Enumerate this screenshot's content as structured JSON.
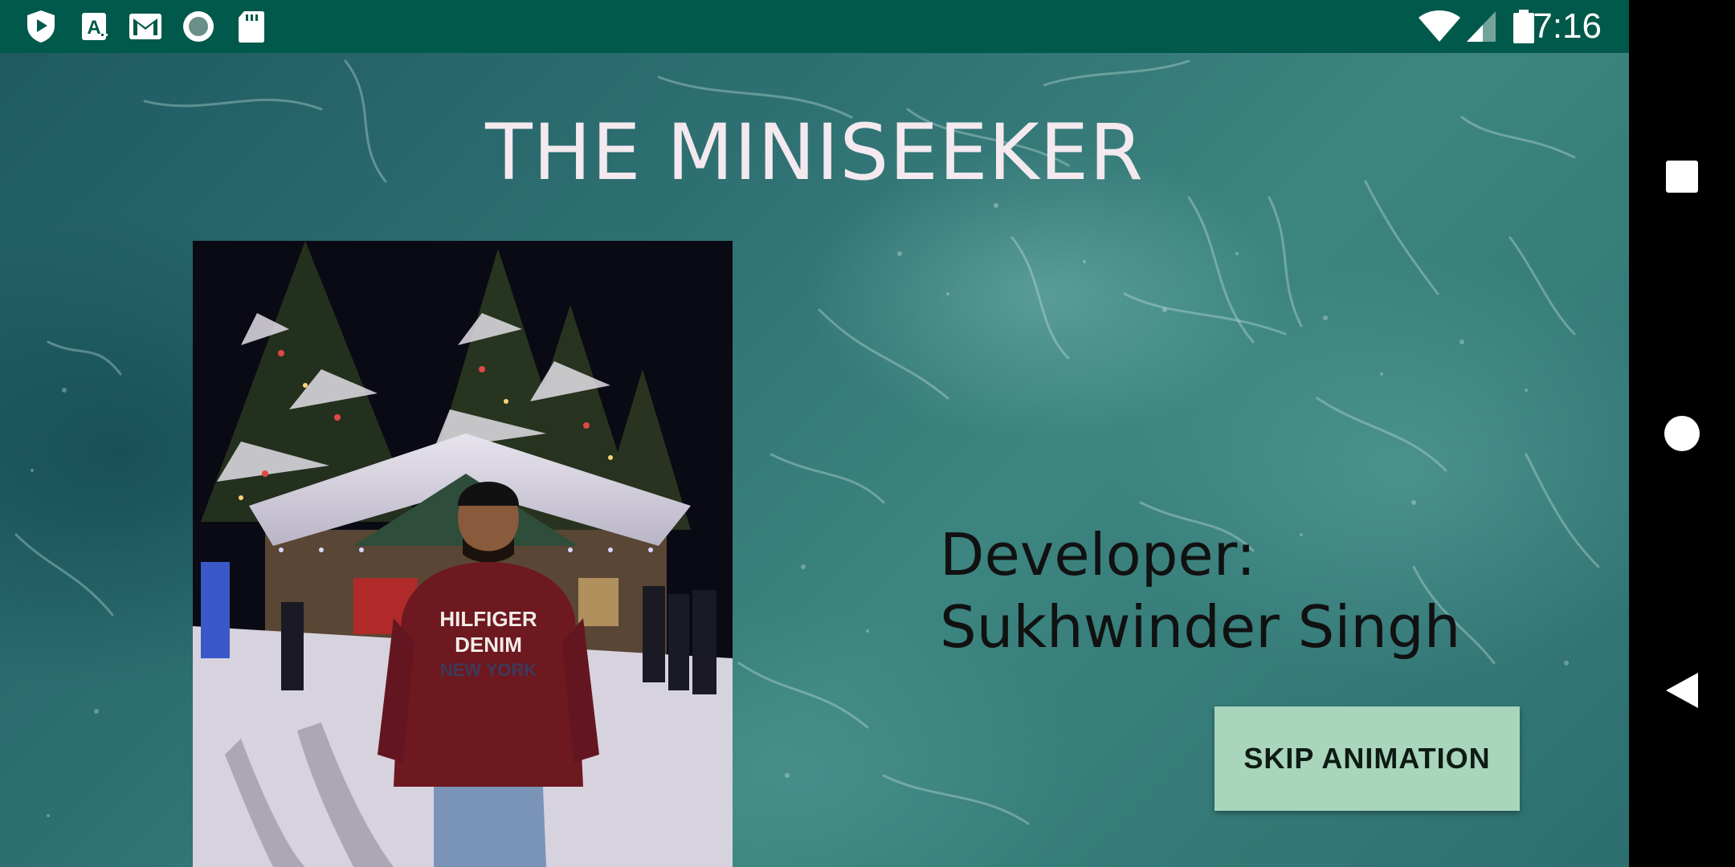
{
  "status_bar": {
    "time": "7:16",
    "left_icons": [
      "play-protect-icon",
      "text-a-icon",
      "gmail-icon",
      "circle-icon",
      "sd-card-icon"
    ],
    "right_icons": [
      "wifi-icon",
      "signal-icon",
      "battery-icon"
    ],
    "background": "#00594a"
  },
  "app": {
    "title": "THE MINISEEKER",
    "developer_label": "Developer:",
    "developer_name": "Sukhwinder Singh",
    "skip_button_label": "SKIP ANIMATION",
    "skip_button_color": "#a8d5bb"
  },
  "nav_bar": {
    "buttons": [
      "recents-icon",
      "home-icon",
      "back-icon"
    ]
  }
}
